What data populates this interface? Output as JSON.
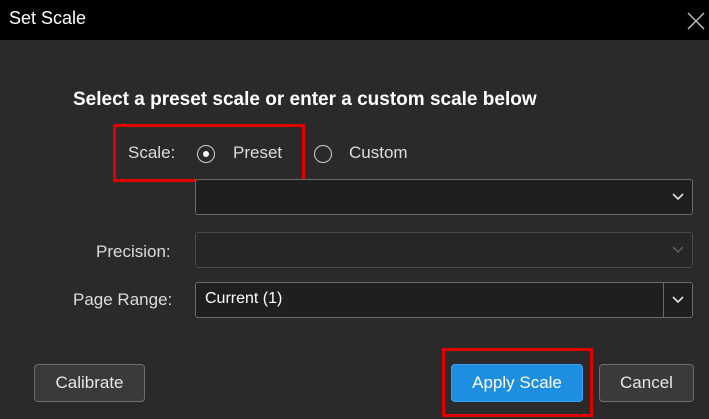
{
  "dialog": {
    "title": "Set Scale",
    "heading": "Select a preset scale or enter a custom scale below"
  },
  "scale": {
    "label": "Scale:",
    "options": [
      {
        "label": "Preset",
        "checked": true
      },
      {
        "label": "Custom",
        "checked": false
      }
    ],
    "preset_value": ""
  },
  "precision": {
    "label": "Precision:",
    "value": "",
    "disabled": true
  },
  "page_range": {
    "label": "Page Range:",
    "value": "Current (1)"
  },
  "buttons": {
    "calibrate": "Calibrate",
    "apply": "Apply Scale",
    "cancel": "Cancel"
  },
  "colors": {
    "accent": "#1e8fe0",
    "highlight": "#e00000",
    "background": "#2a2a2a",
    "titlebar": "#000000"
  },
  "icons": {
    "close": "close-icon",
    "dropdown": "chevron-down-icon"
  }
}
